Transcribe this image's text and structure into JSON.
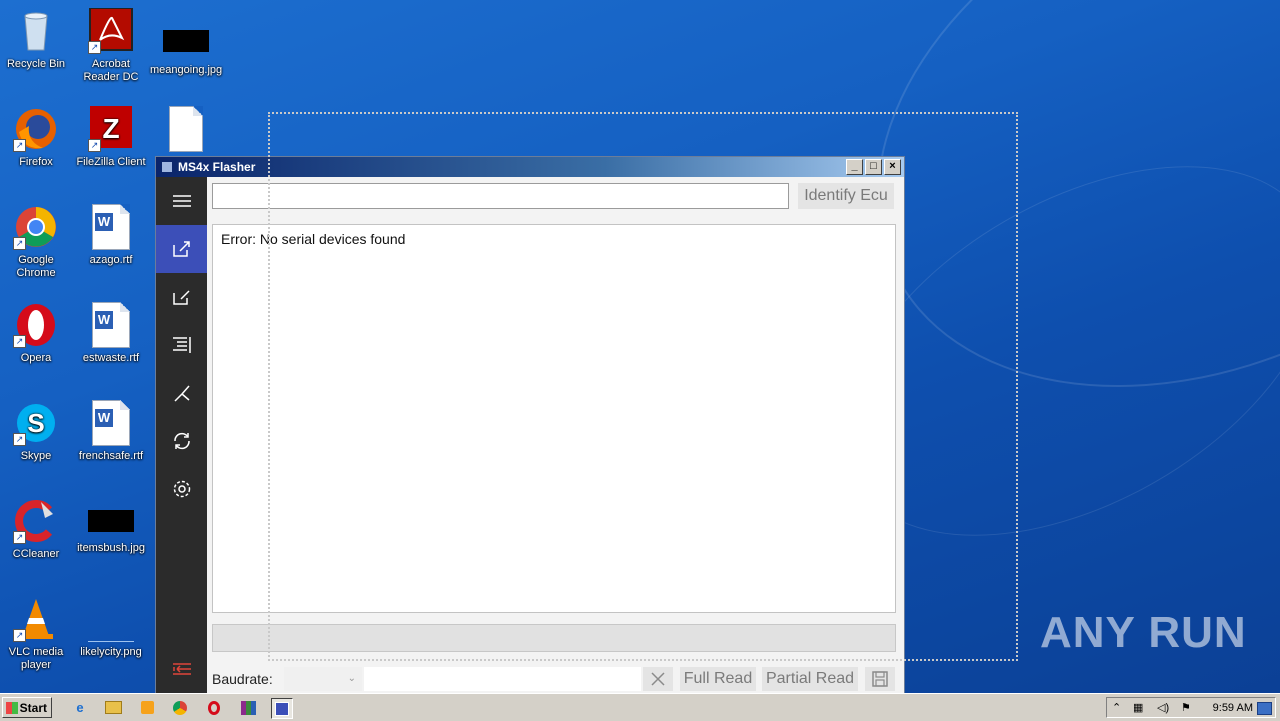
{
  "desktop": {
    "icons": [
      {
        "label": "Recycle Bin"
      },
      {
        "label": "Acrobat Reader DC"
      },
      {
        "label": "meangoing.jpg"
      },
      {
        "label": "Firefox"
      },
      {
        "label": "FileZilla Client"
      },
      {
        "label": "Google Chrome"
      },
      {
        "label": "azago.rtf"
      },
      {
        "label": "Opera"
      },
      {
        "label": "estwaste.rtf"
      },
      {
        "label": "Skype"
      },
      {
        "label": "frenchsafe.rtf"
      },
      {
        "label": "CCleaner"
      },
      {
        "label": "itemsbush.jpg"
      },
      {
        "label": "VLC media player"
      },
      {
        "label": "likelycity.png"
      }
    ],
    "watermark": "ANY RUN"
  },
  "window": {
    "title": "MS4x Flasher",
    "identify_label": "Identify Ecu",
    "output_text": "Error: No serial devices found",
    "baudrate_label": "Baudrate:",
    "full_read_label": "Full Read",
    "partial_read_label": "Partial Read",
    "sidebar": [
      "menu-icon",
      "connect-icon",
      "write-icon",
      "log-icon",
      "tools-icon",
      "refresh-icon",
      "settings-icon",
      "collapse-icon"
    ]
  },
  "taskbar": {
    "start_label": "Start",
    "clock": "9:59 AM"
  },
  "colors": {
    "sidebar_bg": "#2b2b2b",
    "sidebar_active": "#3c4fb8",
    "desktop_blue": "#1560c2"
  }
}
